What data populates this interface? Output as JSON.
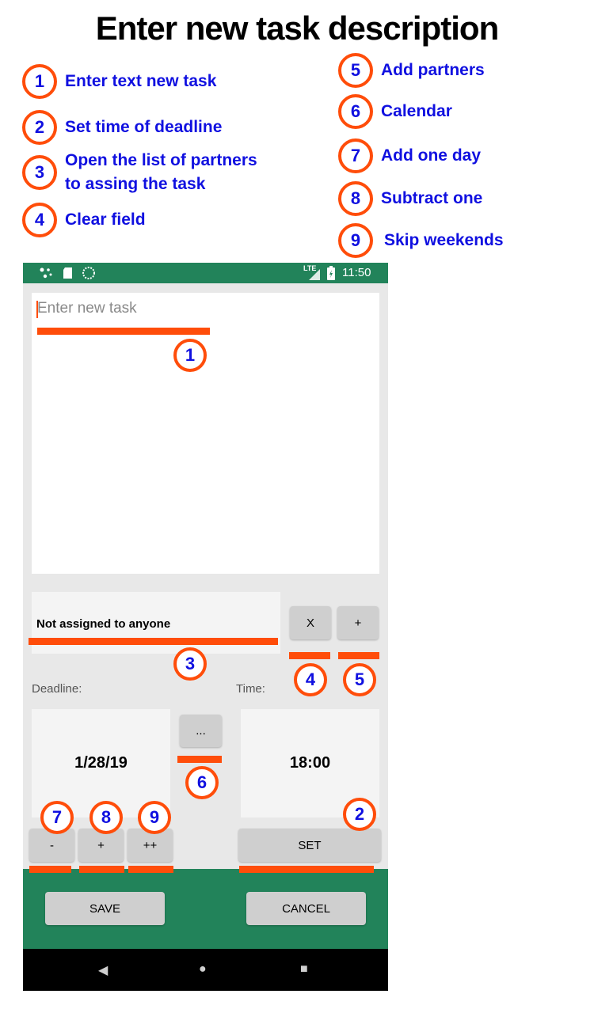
{
  "title": "Enter new task description",
  "legend": [
    {
      "num": "1",
      "text": "Enter text new task"
    },
    {
      "num": "2",
      "text": "Set time of deadline"
    },
    {
      "num": "3",
      "text": "Open the list of partners\nto assing the task"
    },
    {
      "num": "4",
      "text": "Clear field"
    },
    {
      "num": "5",
      "text": "Add partners"
    },
    {
      "num": "6",
      "text": "Calendar"
    },
    {
      "num": "7",
      "text": "Add one day"
    },
    {
      "num": "8",
      "text": "Subtract one"
    },
    {
      "num": "9",
      "text": "Skip weekends"
    }
  ],
  "colors": {
    "accent": "#ff4d0a",
    "annotation_text": "#1010e0",
    "app_green": "#22835a"
  },
  "status_bar": {
    "network": "LTE",
    "time": "11:50"
  },
  "app": {
    "task_placeholder": "Enter new task",
    "assign_text": "Not assigned to anyone",
    "clear_label": "X",
    "add_partner_label": "+",
    "deadline_label": "Deadline:",
    "time_label": "Time:",
    "calendar_label": "...",
    "date_value": "1/28/19",
    "time_value": "18:00",
    "minus_label": "-",
    "plus_label": "+",
    "skip_label": "++",
    "set_label": "SET",
    "save_label": "SAVE",
    "cancel_label": "CANCEL"
  },
  "nav": {
    "back_icon": "◀",
    "home_icon": "●",
    "recents_icon": "■"
  }
}
